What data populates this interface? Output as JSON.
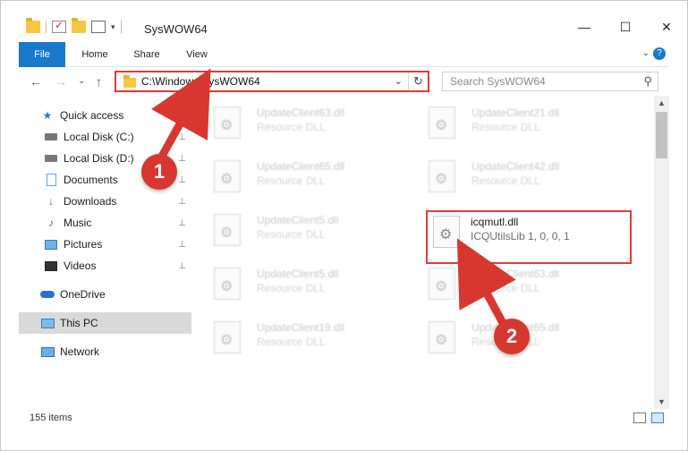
{
  "window": {
    "title": "SysWOW64",
    "buttons": [
      "—",
      "☐",
      "✕"
    ]
  },
  "qat": {
    "dropdown": "▾"
  },
  "ribbon": {
    "tabs": [
      "File",
      "Home",
      "Share",
      "View"
    ],
    "expand": "⌄",
    "help": "?"
  },
  "nav": {
    "back": "←",
    "forward": "→",
    "recent": "⌄",
    "up": "↑",
    "address": "C:\\Windows\\SysWOW64",
    "address_dropdown": "⌄",
    "refresh": "↻",
    "search_placeholder": "Search SysWOW64",
    "search_icon": "search-icon"
  },
  "sidebar": {
    "items": [
      {
        "label": "Quick access",
        "icon": "star-icon",
        "pinned": false
      },
      {
        "label": "Local Disk (C:)",
        "icon": "disk-icon",
        "pinned": true
      },
      {
        "label": "Local Disk (D:)",
        "icon": "disk-icon",
        "pinned": true
      },
      {
        "label": "Documents",
        "icon": "documents-icon",
        "pinned": true
      },
      {
        "label": "Downloads",
        "icon": "downloads-icon",
        "pinned": true
      },
      {
        "label": "Music",
        "icon": "music-icon",
        "pinned": true
      },
      {
        "label": "Pictures",
        "icon": "pictures-icon",
        "pinned": true
      },
      {
        "label": "Videos",
        "icon": "videos-icon",
        "pinned": true
      },
      {
        "label": "OneDrive",
        "icon": "onedrive-icon",
        "pinned": false
      },
      {
        "label": "This PC",
        "icon": "this-pc-icon",
        "pinned": false,
        "selected": true
      },
      {
        "label": "Network",
        "icon": "network-icon",
        "pinned": false
      }
    ],
    "pin_glyph": "📌"
  },
  "files": [
    {
      "name": "UpdateClient63.dll",
      "type": "Resource DLL"
    },
    {
      "name": "UpdateClient21.dll",
      "type": "Resource DLL"
    },
    {
      "name": "UpdateClient65.dll",
      "type": "Resource DLL"
    },
    {
      "name": "UpdateClient42.dll",
      "type": "Resource DLL"
    },
    {
      "name": "UpdateClient5.dll",
      "type": "Resource DLL"
    },
    {
      "name": "icqmutl.dll",
      "type": "ICQUtilsLib 1, 0, 0, 1",
      "highlighted": true
    },
    {
      "name": "UpdateClient5.dll",
      "type": "Resource DLL"
    },
    {
      "name": "UpdateClient63.dll",
      "type": "Resource DLL"
    },
    {
      "name": "UpdateClient19.dll",
      "type": "Resource DLL"
    },
    {
      "name": "UpdateClient65.dll",
      "type": "Resource DLL"
    }
  ],
  "status": {
    "count": "155 items"
  },
  "annotations": {
    "marker1": "1",
    "marker2": "2",
    "color": "#d7372f"
  }
}
